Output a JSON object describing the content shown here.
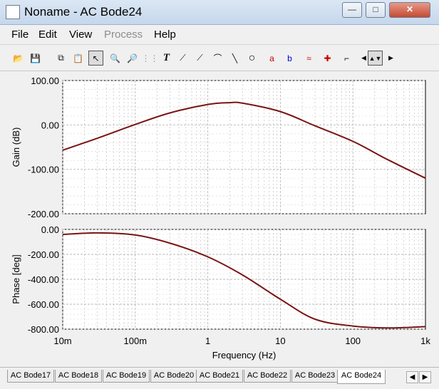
{
  "window": {
    "title": "Noname - AC Bode24",
    "minimize_label": "—",
    "maximize_label": "□",
    "close_label": "✕"
  },
  "menu": [
    {
      "label": "File",
      "enabled": true
    },
    {
      "label": "Edit",
      "enabled": true
    },
    {
      "label": "View",
      "enabled": true
    },
    {
      "label": "Process",
      "enabled": false
    },
    {
      "label": "Help",
      "enabled": true
    }
  ],
  "toolbar": {
    "buttons": [
      "open-icon",
      "save-icon",
      "copy-icon",
      "paste-icon",
      "select-arrow-icon",
      "zoom-in-icon",
      "zoom-out-icon",
      "grid-icon",
      "text-icon",
      "label-icon",
      "label2-icon",
      "label3-icon",
      "line-icon",
      "circle-icon",
      "cursor-a-icon",
      "cursor-b-icon",
      "add-curve-icon",
      "pick-icon",
      "slope-icon",
      "nav-left-icon",
      "nav-updown-icon",
      "nav-right-icon"
    ],
    "text_tool_label": "T",
    "cursor_a_label": "a",
    "cursor_b_label": "b"
  },
  "chart_data": [
    {
      "type": "line",
      "ylabel": "Gain (dB)",
      "yticks": [
        "100.00",
        "0.00",
        "-100.00",
        "-200.00"
      ],
      "ylim": [
        -200,
        100
      ],
      "x_scale": "log",
      "xlim": [
        0.01,
        1000
      ],
      "grid": true,
      "series": [
        {
          "x": [
            0.01,
            0.03,
            0.1,
            0.3,
            1,
            2,
            3,
            10,
            30,
            100,
            300,
            1000
          ],
          "values": [
            -57,
            -30,
            1,
            27,
            46,
            50,
            49,
            30,
            -2,
            -37,
            -78,
            -120
          ]
        }
      ]
    },
    {
      "type": "line",
      "ylabel": "Phase [deg]",
      "yticks": [
        "0.00",
        "-200.00",
        "-400.00",
        "-600.00",
        "-800.00"
      ],
      "ylim": [
        -800,
        0
      ],
      "x_scale": "log",
      "xlim": [
        0.01,
        1000
      ],
      "xticks": [
        "10m",
        "100m",
        "1",
        "10",
        "100",
        "1k"
      ],
      "xlabel": "Frequency (Hz)",
      "grid": true,
      "series": [
        {
          "x": [
            0.01,
            0.03,
            0.1,
            0.3,
            1,
            3,
            10,
            30,
            100,
            300,
            1000
          ],
          "values": [
            -40,
            -28,
            -45,
            -110,
            -220,
            -365,
            -560,
            -720,
            -775,
            -790,
            -780
          ]
        }
      ]
    }
  ],
  "colors": {
    "curve": "#7a1414",
    "grid": "#b7b7b7",
    "plot_bg": "#ffffff"
  },
  "tabs": [
    {
      "label": "AC Bode17",
      "active": false
    },
    {
      "label": "AC Bode18",
      "active": false
    },
    {
      "label": "AC Bode19",
      "active": false
    },
    {
      "label": "AC Bode20",
      "active": false
    },
    {
      "label": "AC Bode21",
      "active": false
    },
    {
      "label": "AC Bode22",
      "active": false
    },
    {
      "label": "AC Bode23",
      "active": false
    },
    {
      "label": "AC Bode24",
      "active": true
    }
  ],
  "tab_scroll": {
    "left_label": "◀",
    "right_label": "▶"
  }
}
